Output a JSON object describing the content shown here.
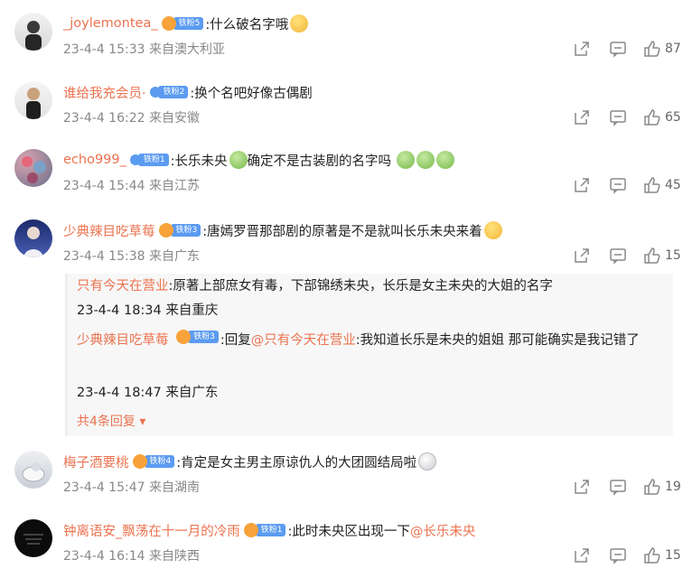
{
  "comments": [
    {
      "username": "_joylemontea_",
      "badge": "铁粉5",
      "text": ":什么破名字哦",
      "time": "23-4-4 15:33",
      "location": "来自澳大利亚",
      "likes": "87"
    },
    {
      "username": "谁给我充会员·",
      "badge": "铁粉2",
      "text": ":换个名吧好像古偶剧",
      "time": "23-4-4 16:22",
      "location": "来自安徽",
      "likes": "65"
    },
    {
      "username": "echo999_",
      "badge": "铁粉1",
      "text1": ":长乐未央",
      "text2": "确定不是古装剧的名字吗",
      "time": "23-4-4 15:44",
      "location": "来自江苏",
      "likes": "45"
    },
    {
      "username": "少典辣目吃草莓",
      "badge": "铁粉3",
      "text": ":唐嫣罗晋那部剧的原著是不是就叫长乐未央来着",
      "time": "23-4-4 15:38",
      "location": "来自广东",
      "likes": "15"
    },
    {
      "username": "梅子酒要桃",
      "badge": "铁粉4",
      "text": ":肯定是女主男主原谅仇人的大团圆结局啦",
      "time": "23-4-4 15:47",
      "location": "来自湖南",
      "likes": "19"
    },
    {
      "username": "钟离语安_飘荡在十一月的冷雨",
      "badge": "铁粉1",
      "text": ":此时未央区出现一下",
      "mention": "@长乐未央",
      "time": "23-4-4 16:14",
      "location": "来自陕西",
      "likes": "15"
    }
  ],
  "replies": [
    {
      "username": "只有今天在营业",
      "text": ":原著上部庶女有毒，下部锦绣未央，长乐是女主未央的大姐的名字",
      "time": "23-4-4 18:34",
      "location": "来自重庆"
    },
    {
      "username": "少典辣目吃草莓",
      "badge": "铁粉3",
      "prefix": ":回复",
      "mention": "@只有今天在营业",
      "text": ":我知道长乐是未央的姐姐 那可能确实是我记错了",
      "time": "23-4-4 18:47",
      "location": "来自广东"
    }
  ],
  "more_replies": "共4条回复",
  "icons": {
    "share": "share-icon",
    "comment": "comment-icon",
    "like": "thumbs-up-icon"
  },
  "colors": {
    "username": "#eb7350",
    "badge": "#5b9bf0",
    "meta": "#888888"
  }
}
